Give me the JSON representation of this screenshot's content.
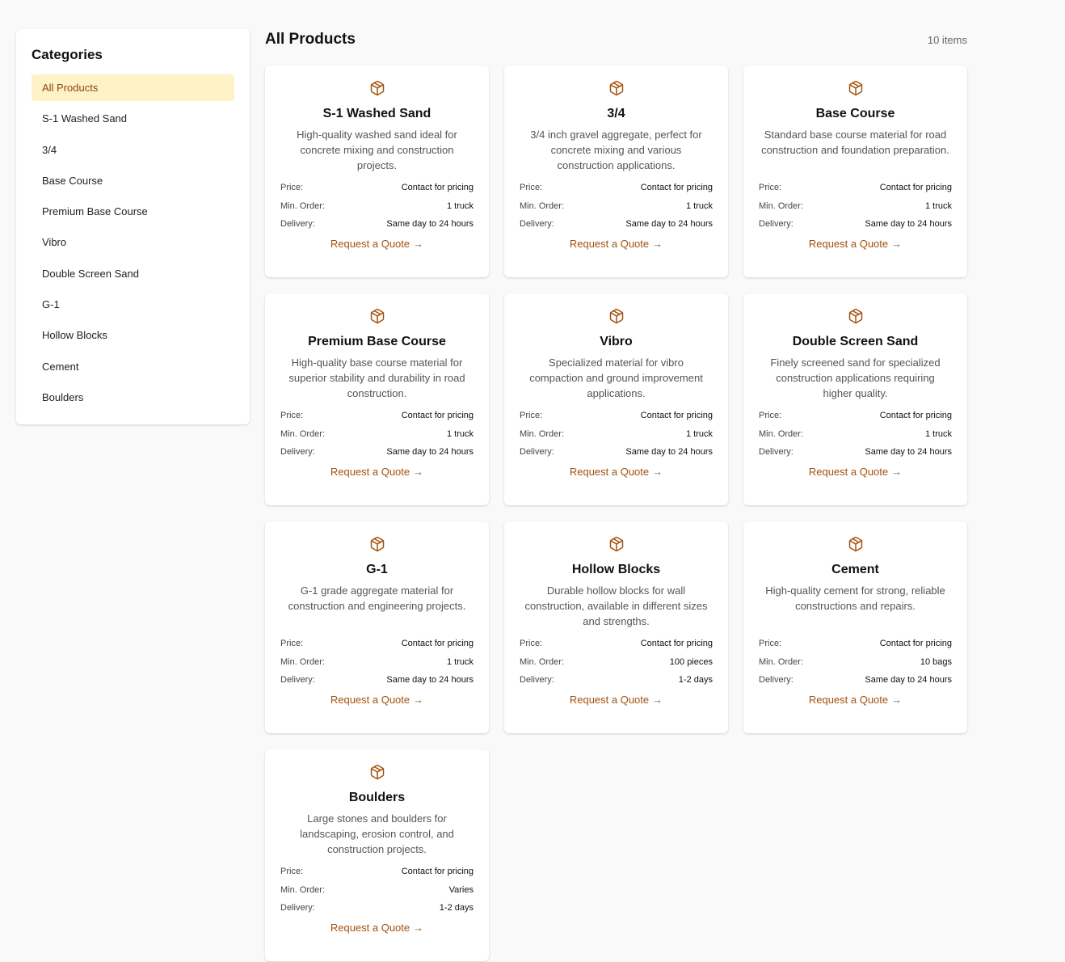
{
  "sidebar": {
    "title": "Categories",
    "items": [
      {
        "label": "All Products",
        "active": true
      },
      {
        "label": "S-1 Washed Sand"
      },
      {
        "label": "3/4"
      },
      {
        "label": "Base Course"
      },
      {
        "label": "Premium Base Course"
      },
      {
        "label": "Vibro"
      },
      {
        "label": "Double Screen Sand"
      },
      {
        "label": "G-1"
      },
      {
        "label": "Hollow Blocks"
      },
      {
        "label": "Cement"
      },
      {
        "label": "Boulders"
      }
    ]
  },
  "main": {
    "title": "All Products",
    "count": "10 items",
    "labels": {
      "price": "Price:",
      "min_order": "Min. Order:",
      "delivery": "Delivery:",
      "quote": "Request a Quote",
      "quote_arrow": "→"
    },
    "icon": "box-icon",
    "accent_color": "#a3520f",
    "active_bg": "#fef3c7",
    "products": [
      {
        "name": "S-1 Washed Sand",
        "desc": "High-quality washed sand ideal for concrete mixing and construction projects.",
        "price": "Contact for pricing",
        "min_order": "1 truck",
        "delivery": "Same day to 24 hours"
      },
      {
        "name": "3/4",
        "desc": "3/4 inch gravel aggregate, perfect for concrete mixing and various construction applications.",
        "price": "Contact for pricing",
        "min_order": "1 truck",
        "delivery": "Same day to 24 hours"
      },
      {
        "name": "Base Course",
        "desc": "Standard base course material for road construction and foundation preparation.",
        "price": "Contact for pricing",
        "min_order": "1 truck",
        "delivery": "Same day to 24 hours"
      },
      {
        "name": "Premium Base Course",
        "desc": "High-quality base course material for superior stability and durability in road construction.",
        "price": "Contact for pricing",
        "min_order": "1 truck",
        "delivery": "Same day to 24 hours"
      },
      {
        "name": "Vibro",
        "desc": "Specialized material for vibro compaction and ground improvement applications.",
        "price": "Contact for pricing",
        "min_order": "1 truck",
        "delivery": "Same day to 24 hours"
      },
      {
        "name": "Double Screen Sand",
        "desc": "Finely screened sand for specialized construction applications requiring higher quality.",
        "price": "Contact for pricing",
        "min_order": "1 truck",
        "delivery": "Same day to 24 hours"
      },
      {
        "name": "G-1",
        "desc": "G-1 grade aggregate material for construction and engineering projects.",
        "price": "Contact for pricing",
        "min_order": "1 truck",
        "delivery": "Same day to 24 hours"
      },
      {
        "name": "Hollow Blocks",
        "desc": "Durable hollow blocks for wall construction, available in different sizes and strengths.",
        "price": "Contact for pricing",
        "min_order": "100 pieces",
        "delivery": "1-2 days"
      },
      {
        "name": "Cement",
        "desc": "High-quality cement for strong, reliable constructions and repairs.",
        "price": "Contact for pricing",
        "min_order": "10 bags",
        "delivery": "Same day to 24 hours"
      },
      {
        "name": "Boulders",
        "desc": "Large stones and boulders for landscaping, erosion control, and construction projects.",
        "price": "Contact for pricing",
        "min_order": "Varies",
        "delivery": "1-2 days"
      }
    ]
  }
}
